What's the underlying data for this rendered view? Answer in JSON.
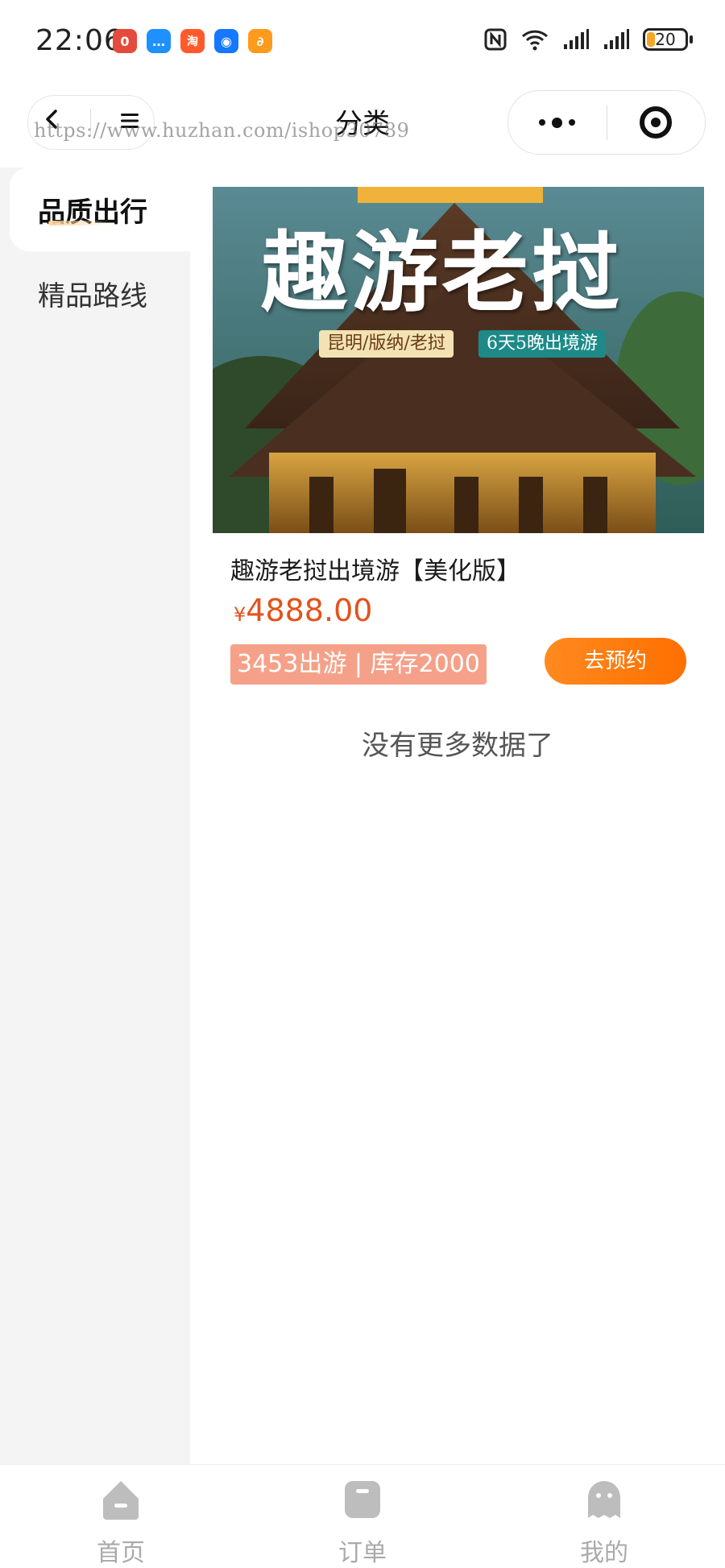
{
  "status_bar": {
    "time": "22:06",
    "app_icons": [
      {
        "name": "notification-app-icon",
        "color": "#e54b3c",
        "glyph": "0"
      },
      {
        "name": "chat-app-icon",
        "color": "#1e90ff",
        "glyph": "…"
      },
      {
        "name": "taobao-app-icon",
        "color": "#ff5a2b",
        "glyph": "淘"
      },
      {
        "name": "robot-app-icon",
        "color": "#1677ff",
        "glyph": "◉"
      },
      {
        "name": "orange-app-icon",
        "color": "#ff9b1c",
        "glyph": "∂"
      }
    ],
    "battery_level": "20"
  },
  "navbar": {
    "title": "分类",
    "back_icon": "chevron-left-icon",
    "home_icon": "menu-icon",
    "watermark": "https://www.huzhan.com/ishop30789"
  },
  "sidebar": {
    "items": [
      {
        "label": "品质出行",
        "active": true
      },
      {
        "label": "精品路线",
        "active": false
      }
    ]
  },
  "product": {
    "banner": {
      "headline": "趣游老挝",
      "route": "昆明/版纳/老挝",
      "duration": "6天5晚出境游"
    },
    "title": "趣游老挝出境游【美化版】",
    "currency": "¥",
    "price": "4888.00",
    "stats": "3453出游 | 库存2000",
    "book_label": "去预约"
  },
  "list_footer": "没有更多数据了",
  "tabbar": {
    "items": [
      {
        "label": "首页",
        "icon": "home-icon"
      },
      {
        "label": "订单",
        "icon": "order-icon"
      },
      {
        "label": "我的",
        "icon": "profile-icon"
      }
    ]
  },
  "colors": {
    "accent": "#ff7a00",
    "price": "#e2531e",
    "badge": "#f5a189",
    "sidebar_bg": "#f4f4f4",
    "tab_inactive": "#aaaaaa"
  }
}
